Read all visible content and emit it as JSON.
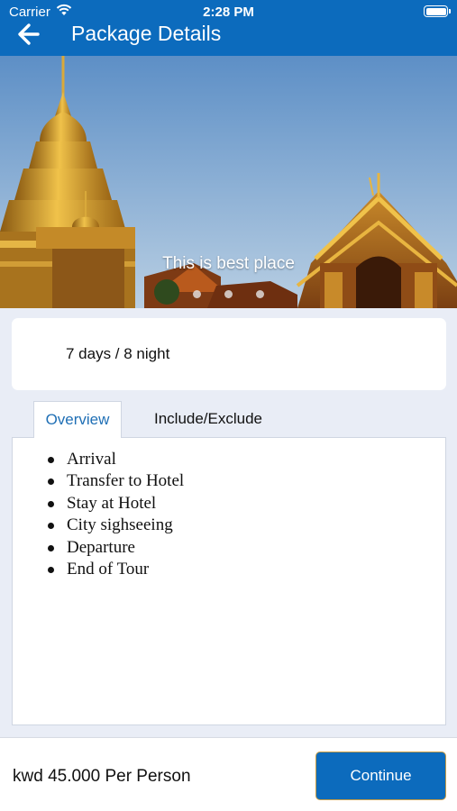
{
  "status_bar": {
    "carrier": "Carrier",
    "time": "2:28 PM"
  },
  "header": {
    "title": "Package Details",
    "back_icon": "arrow-left-icon"
  },
  "hero": {
    "caption": "This is best place",
    "dot_count": 3
  },
  "package": {
    "duration": "7 days / 8 night"
  },
  "tabs": [
    {
      "label": "Overview",
      "active": true
    },
    {
      "label": "Include/Exclude",
      "active": false
    }
  ],
  "overview": {
    "items": [
      "Arrival",
      "Transfer to Hotel",
      "Stay at Hotel",
      "City sighseeing",
      "Departure",
      "End of Tour"
    ]
  },
  "footer": {
    "price": "kwd 45.000  Per Person",
    "continue_label": "Continue"
  },
  "colors": {
    "primary": "#0c6bbd",
    "background": "#e9edf6",
    "tab_active_text": "#1f6fb5",
    "button_border": "#c79c45"
  }
}
